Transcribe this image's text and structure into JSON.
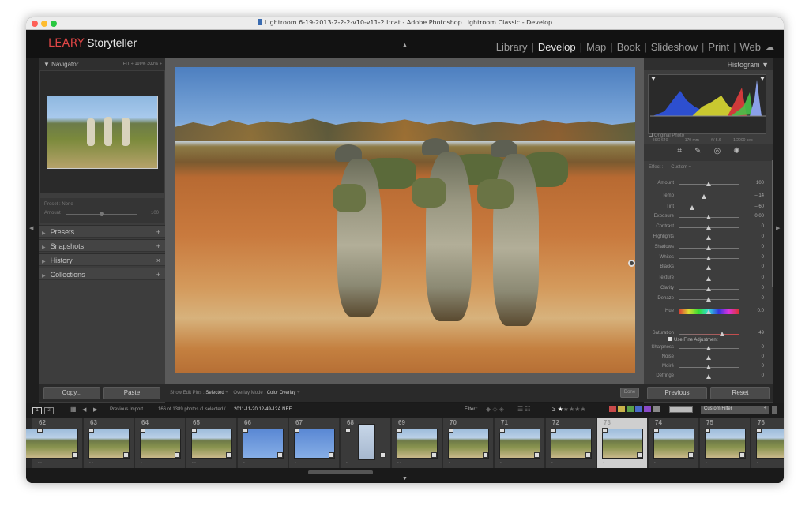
{
  "titlebar": {
    "title": "Lightroom 6-19-2013-2-2-2-v10-v11-2.lrcat - Adobe Photoshop Lightroom Classic - Develop",
    "colors": {
      "close": "#fe5f57",
      "min": "#febc2e",
      "max": "#28c840"
    }
  },
  "identity": {
    "logo_mark": "LEARY",
    "logo_text": "Storyteller"
  },
  "modules": [
    {
      "label": "Library",
      "active": false
    },
    {
      "label": "Develop",
      "active": true
    },
    {
      "label": "Map",
      "active": false
    },
    {
      "label": "Book",
      "active": false
    },
    {
      "label": "Slideshow",
      "active": false
    },
    {
      "label": "Print",
      "active": false
    },
    {
      "label": "Web",
      "active": false
    }
  ],
  "left": {
    "navigator": {
      "title": "Navigator",
      "zoom_options": "FIT ÷   100%   300% ÷"
    },
    "preset": {
      "name": "Preset : None",
      "amount_label": "Amount",
      "amount_value": "100"
    },
    "panels": [
      {
        "label": "Presets",
        "action": "+"
      },
      {
        "label": "Snapshots",
        "action": "+"
      },
      {
        "label": "History",
        "action": "×"
      },
      {
        "label": "Collections",
        "action": "+"
      }
    ],
    "copy_label": "Copy...",
    "paste_label": "Paste"
  },
  "toolbar": {
    "show_pins_label": "Show Edit Pins :",
    "show_pins_value": "Selected",
    "overlay_label": "Overlay Mode :",
    "overlay_value": "Color Overlay",
    "done_label": "Done"
  },
  "right": {
    "histogram_title": "Histogram",
    "info": {
      "iso": "ISO 640",
      "focal": "170 mm",
      "aperture": "f / 5.6",
      "shutter": "1/2000 sec"
    },
    "original_photo_label": "Original Photo",
    "effect_label": "Effect :",
    "effect_value": "Custom ÷",
    "sliders": [
      {
        "name": "Amount",
        "value": "100",
        "pos": 0.5
      },
      {
        "name": "Temp",
        "value": "– 14",
        "pos": 0.42
      },
      {
        "name": "Tint",
        "value": "– 60",
        "pos": 0.22
      },
      {
        "name": "Exposure",
        "value": "0.00",
        "pos": 0.5
      },
      {
        "name": "Contrast",
        "value": "0",
        "pos": 0.5
      },
      {
        "name": "Highlights",
        "value": "0",
        "pos": 0.5
      },
      {
        "name": "Shadows",
        "value": "0",
        "pos": 0.5
      },
      {
        "name": "Whites",
        "value": "0",
        "pos": 0.5
      },
      {
        "name": "Blacks",
        "value": "0",
        "pos": 0.5
      },
      {
        "name": "Texture",
        "value": "0",
        "pos": 0.5
      },
      {
        "name": "Clarity",
        "value": "0",
        "pos": 0.5
      },
      {
        "name": "Dehaze",
        "value": "0",
        "pos": 0.5
      },
      {
        "name": "Hue",
        "value": "0.0",
        "pos": 0.5
      },
      {
        "name": "Saturation",
        "value": "49",
        "pos": 0.72
      },
      {
        "name": "Sharpness",
        "value": "0",
        "pos": 0.5
      },
      {
        "name": "Noise",
        "value": "0",
        "pos": 0.5
      },
      {
        "name": "Moiré",
        "value": "0",
        "pos": 0.5
      },
      {
        "name": "Defringe",
        "value": "0",
        "pos": 0.5
      }
    ],
    "fine_adjustment_label": "Use Fine Adjustment",
    "previous_label": "Previous",
    "reset_label": "Reset"
  },
  "filmstrip": {
    "screen1": "1",
    "screen2": "2",
    "source": "Previous Import",
    "count": "166 of 1389 photos /1 selected /",
    "filename": "2011-11-20 12-49-12A.NEF",
    "filter_label": "Filter :",
    "filter_value": "Custom Filter",
    "rating_op": "≥",
    "label_colors": [
      "#c94a4a",
      "#c9b24a",
      "#5aa04a",
      "#4a6ac9",
      "#8a4ac9",
      "#888888"
    ],
    "thumbs": [
      {
        "n": "62",
        "kind": "field",
        "dots": "• •"
      },
      {
        "n": "63",
        "kind": "field",
        "dots": "• •"
      },
      {
        "n": "64",
        "kind": "field",
        "dots": "•"
      },
      {
        "n": "65",
        "kind": "field",
        "dots": "• •"
      },
      {
        "n": "66",
        "kind": "sky",
        "dots": "•"
      },
      {
        "n": "67",
        "kind": "sky",
        "dots": "•"
      },
      {
        "n": "68",
        "kind": "portrait",
        "dots": "•"
      },
      {
        "n": "69",
        "kind": "field",
        "dots": "• •"
      },
      {
        "n": "70",
        "kind": "field",
        "dots": "•"
      },
      {
        "n": "71",
        "kind": "field",
        "dots": "•"
      },
      {
        "n": "72",
        "kind": "field",
        "dots": "•"
      },
      {
        "n": "73",
        "kind": "field",
        "dots": "•",
        "selected": true
      },
      {
        "n": "74",
        "kind": "field",
        "dots": "•"
      },
      {
        "n": "75",
        "kind": "field",
        "dots": "•"
      },
      {
        "n": "76",
        "kind": "field",
        "dots": "•"
      }
    ]
  }
}
